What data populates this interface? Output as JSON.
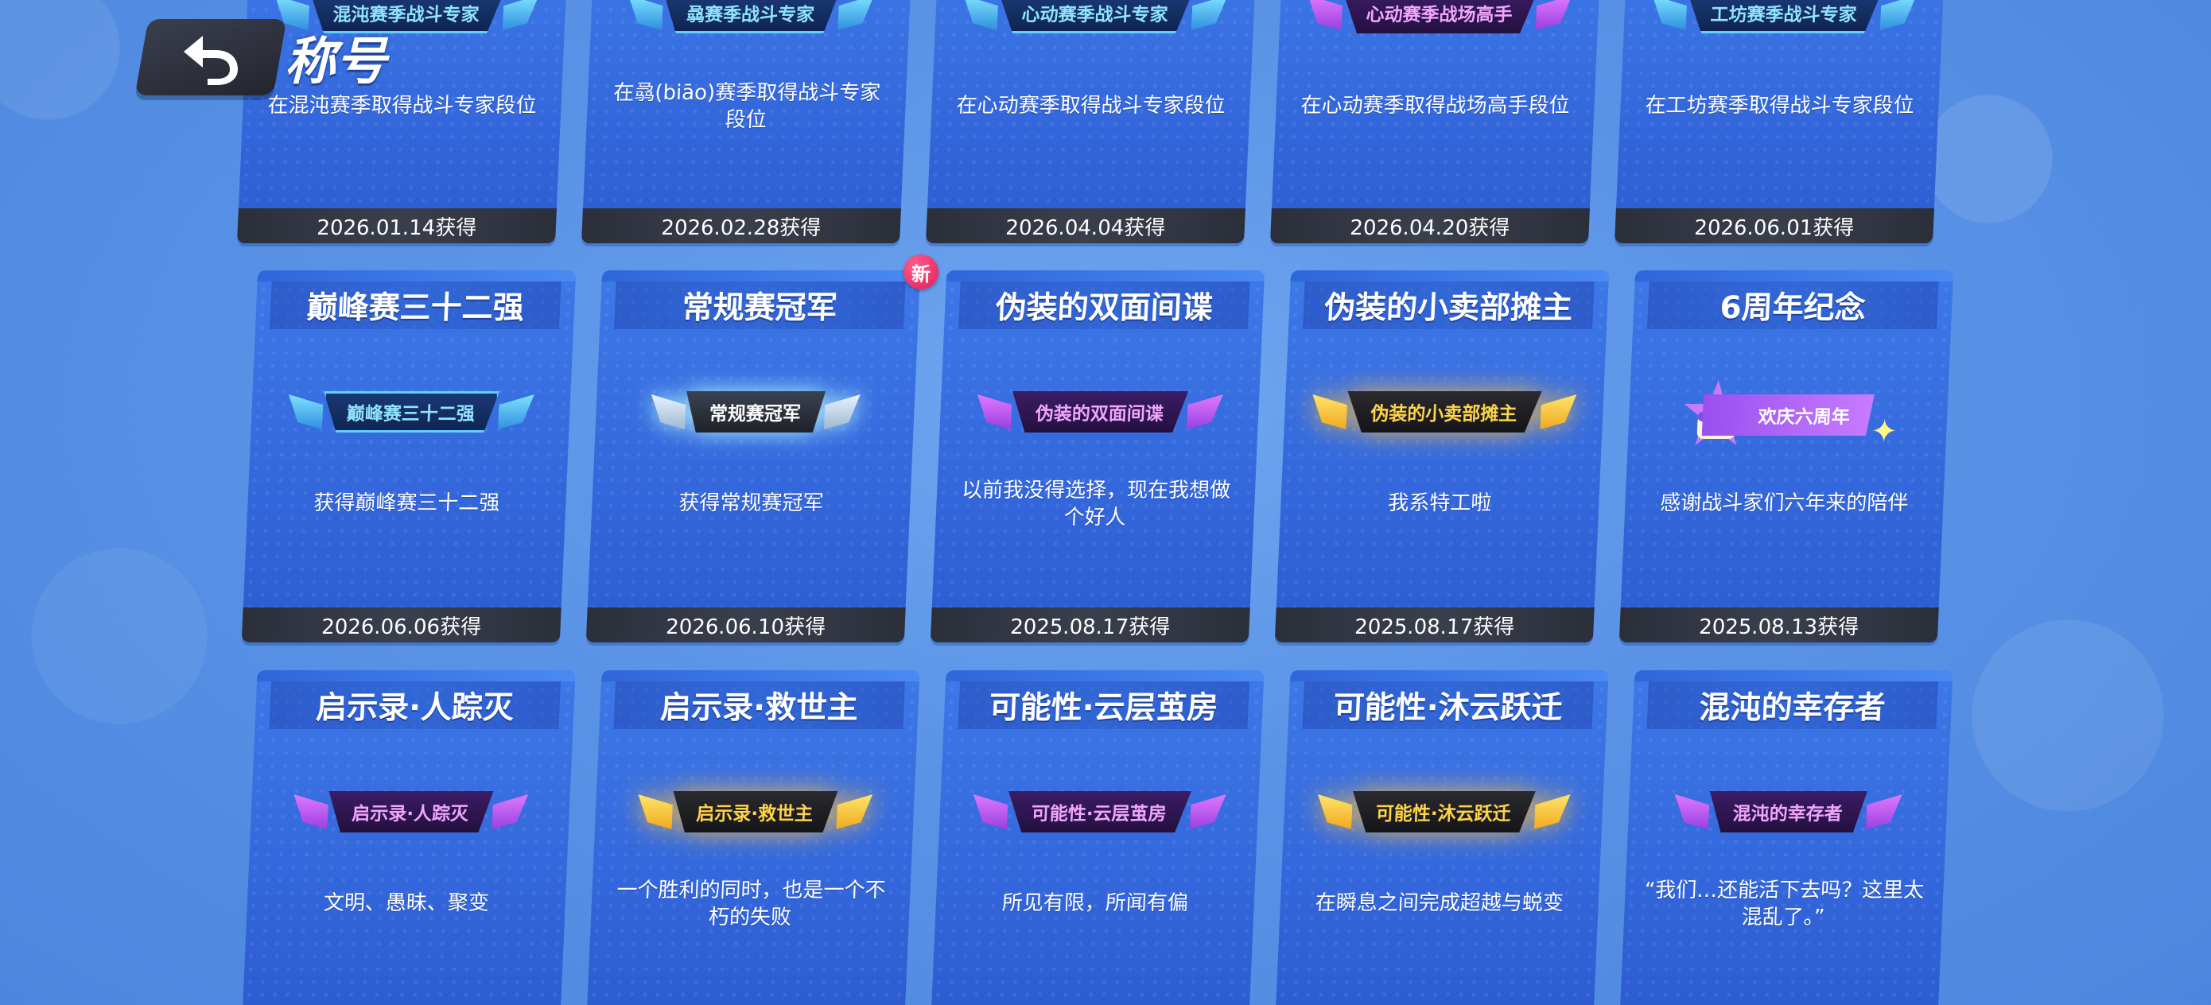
{
  "header": {
    "title": "称号"
  },
  "cards": [
    {
      "name": "",
      "badge": "混沌赛季战斗专家",
      "badge_style": "blue",
      "desc": "在混沌赛季取得战斗专家段位",
      "date": "2026.01.14获得"
    },
    {
      "name": "",
      "badge": "骉赛季战斗专家",
      "badge_style": "blue",
      "desc": "在骉(biāo)赛季取得战斗专家段位",
      "date": "2026.02.28获得"
    },
    {
      "name": "",
      "badge": "心动赛季战斗专家",
      "badge_style": "blue",
      "desc": "在心动赛季取得战斗专家段位",
      "date": "2026.04.04获得"
    },
    {
      "name": "",
      "badge": "心动赛季战场高手",
      "badge_style": "purple",
      "desc": "在心动赛季取得战场高手段位",
      "date": "2026.04.20获得"
    },
    {
      "name": "",
      "badge": "工坊赛季战斗专家",
      "badge_style": "blue",
      "desc": "在工坊赛季取得战斗专家段位",
      "date": "2026.06.01获得"
    },
    {
      "name": "巅峰赛三十二强",
      "badge": "巅峰赛三十二强",
      "badge_style": "blue",
      "desc": "获得巅峰赛三十二强",
      "date": "2026.06.06获得"
    },
    {
      "name": "常规赛冠军",
      "badge": "常规赛冠军",
      "badge_style": "silver",
      "desc": "获得常规赛冠军",
      "date": "2026.06.10获得",
      "new": "新"
    },
    {
      "name": "伪装的双面间谍",
      "badge": "伪装的双面间谍",
      "badge_style": "purple",
      "desc": "以前我没得选择，现在我想做个好人",
      "date": "2025.08.17获得"
    },
    {
      "name": "伪装的小卖部摊主",
      "badge": "伪装的小卖部摊主",
      "badge_style": "gold",
      "desc": "我系特工啦",
      "date": "2025.08.17获得"
    },
    {
      "name": "6周年纪念",
      "badge": "欢庆六周年",
      "badge_style": "anniv",
      "desc": "感谢战斗家们六年来的陪伴",
      "date": "2025.08.13获得"
    },
    {
      "name": "启示录·人踪灭",
      "badge": "启示录·人踪灭",
      "badge_style": "purple",
      "desc": "文明、愚昧、聚变",
      "date": ""
    },
    {
      "name": "启示录·救世主",
      "badge": "启示录·救世主",
      "badge_style": "gold",
      "desc": "一个胜利的同时，也是一个不朽的失败",
      "date": ""
    },
    {
      "name": "可能性·云层茧房",
      "badge": "可能性·云层茧房",
      "badge_style": "purple",
      "desc": "所见有限，所闻有偏",
      "date": ""
    },
    {
      "name": "可能性·沐云跃迁",
      "badge": "可能性·沐云跃迁",
      "badge_style": "gold",
      "desc": "在瞬息之间完成超越与蜕变",
      "date": ""
    },
    {
      "name": "混沌的幸存者",
      "badge": "混沌的幸存者",
      "badge_style": "purple",
      "desc": "“我们…还能活下去吗？这里太混乱了。”",
      "date": ""
    }
  ],
  "colors": {
    "background": "#5a93e6",
    "card": "#3468dc",
    "date_bar": "#2b2f3a",
    "new_badge": "#e01e5a"
  }
}
